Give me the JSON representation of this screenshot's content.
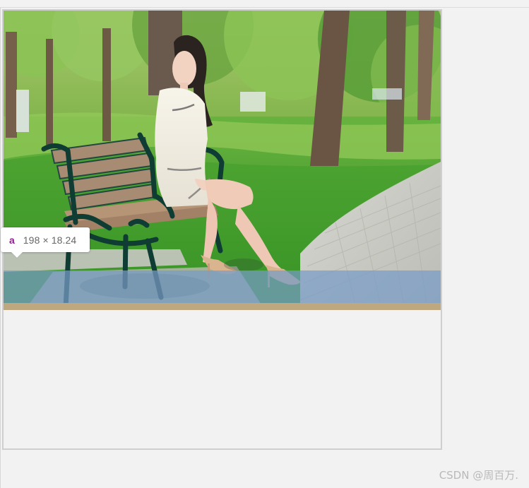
{
  "tooltip": {
    "tag": "a",
    "size": "198 × 18.24"
  },
  "watermark": {
    "text": "CSDN @周百万."
  },
  "colors": {
    "page_background": "#f2f2f2",
    "border": "#cfcfcf",
    "link_highlight": "#779bc6",
    "padding_highlight": "#bda87f",
    "tooltip_tag": "#8e1f8f"
  },
  "icons": {
    "photo": "park-bench-photo"
  }
}
